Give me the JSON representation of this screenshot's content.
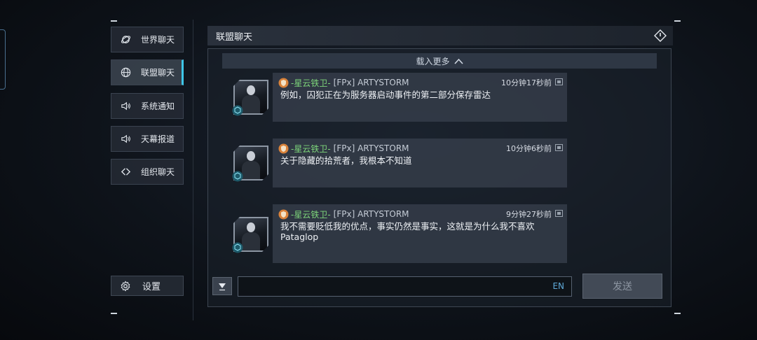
{
  "sidebar": {
    "items": [
      {
        "label": "世界聊天",
        "icon": "globe-orbit-icon"
      },
      {
        "label": "联盟聊天",
        "icon": "globe-icon"
      },
      {
        "label": "系统通知",
        "icon": "speaker-icon"
      },
      {
        "label": "天幕报道",
        "icon": "speaker-icon"
      },
      {
        "label": "组织聊天",
        "icon": "chevrons-icon"
      }
    ],
    "active_index": 1,
    "settings_label": "设置"
  },
  "header": {
    "title": "联盟聊天"
  },
  "chat": {
    "load_more": "载入更多",
    "messages": [
      {
        "guild": "-星云铁卫-",
        "user": "[FPx] ARTYSTORM",
        "time": "10分钟17秒前",
        "text": "例如，囚犯正在为服务器启动事件的第二部分保存雷达"
      },
      {
        "guild": "-星云铁卫-",
        "user": "[FPx] ARTYSTORM",
        "time": "10分钟6秒前",
        "text": "关于隐藏的拾荒者，我根本不知道"
      },
      {
        "guild": "-星云铁卫-",
        "user": "[FPx] ARTYSTORM",
        "time": "9分钟27秒前",
        "text": "我不需要贬低我的优点，事实仍然是事实，这就是为什么我不喜欢Pataglop"
      }
    ]
  },
  "composer": {
    "value": "",
    "placeholder": "",
    "lang": "EN",
    "send_label": "发送"
  },
  "colors": {
    "accent": "#3ec6e8",
    "guild_green": "#7dd47a",
    "lang_blue": "#5fa9d8"
  }
}
